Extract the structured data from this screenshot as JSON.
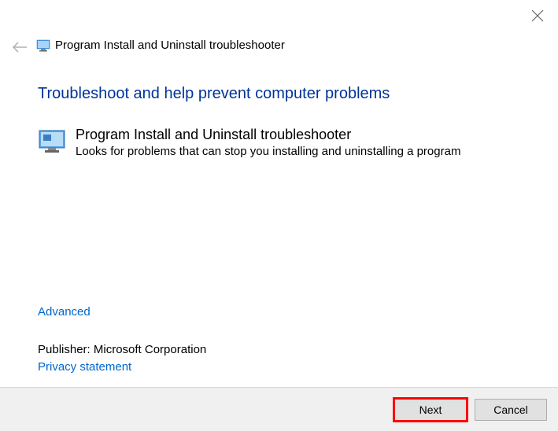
{
  "header": {
    "title": "Program Install and Uninstall troubleshooter"
  },
  "main": {
    "heading": "Troubleshoot and help prevent computer problems",
    "program": {
      "title": "Program Install and Uninstall troubleshooter",
      "description": "Looks for problems that can stop you installing and uninstalling a program"
    }
  },
  "links": {
    "advanced": "Advanced",
    "privacy": "Privacy statement"
  },
  "publisher": {
    "label": "Publisher:",
    "value": "Microsoft Corporation"
  },
  "footer": {
    "next": "Next",
    "cancel": "Cancel"
  }
}
